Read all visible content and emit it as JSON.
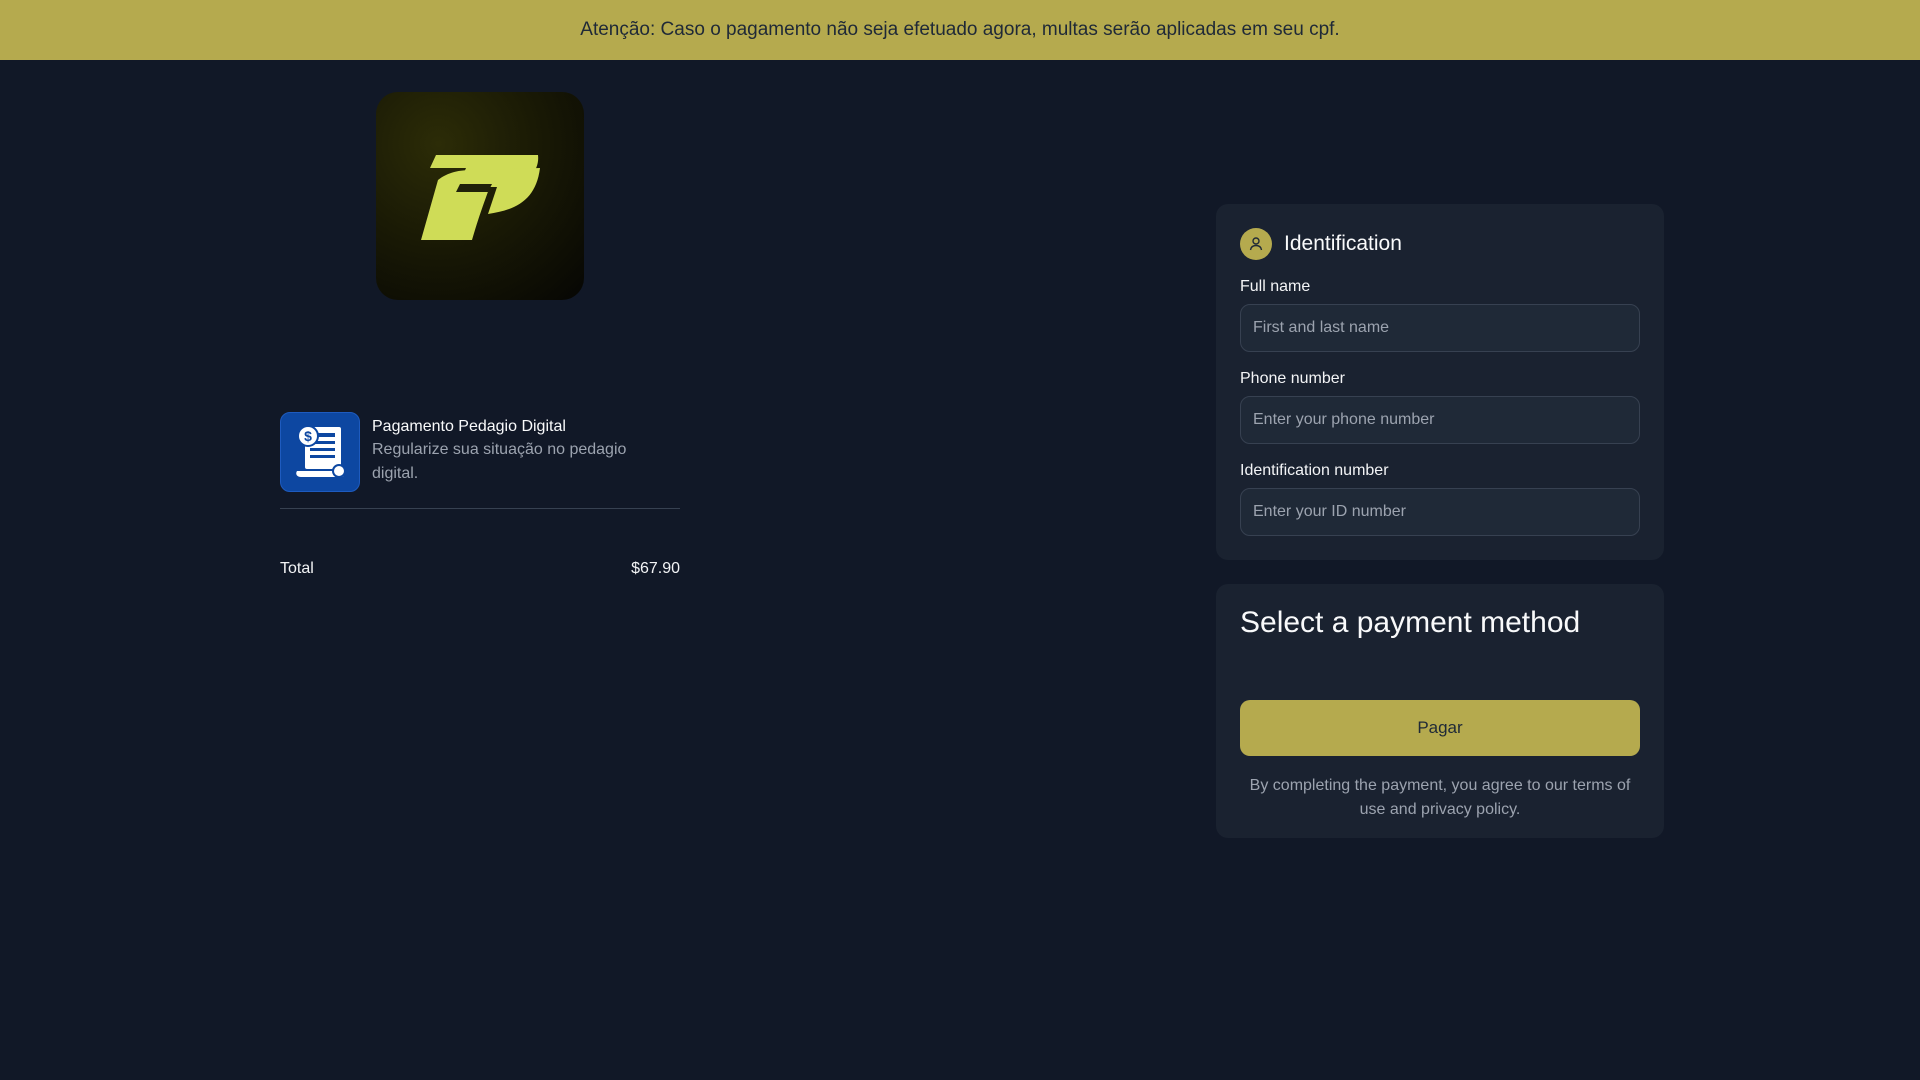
{
  "banner": {
    "text": "Atenção: Caso o pagamento não seja efetuado agora, multas serão aplicadas em seu cpf."
  },
  "logo": {
    "icon": "brand-p-logo",
    "accent_color": "#cfdc57"
  },
  "order": {
    "product": {
      "icon": "receipt-dollar-icon",
      "name": "Pagamento Pedagio Digital",
      "description": "Regularize sua situação no pedagio digital."
    },
    "total_label": "Total",
    "total_value": "$67.90"
  },
  "identification": {
    "title": "Identification",
    "icon": "user-icon",
    "fields": [
      {
        "label": "Full name",
        "placeholder": "First and last name"
      },
      {
        "label": "Phone number",
        "placeholder": "Enter your phone number"
      },
      {
        "label": "Identification number",
        "placeholder": "Enter your ID number"
      }
    ]
  },
  "payment": {
    "title": "Select a payment method",
    "button_label": "Pagar",
    "terms": "By completing the payment, you agree to our terms of use and privacy policy."
  },
  "colors": {
    "background": "#111827",
    "card": "#1a2230",
    "accent": "#b5aa4e",
    "product_thumb": "#0d47a1"
  }
}
